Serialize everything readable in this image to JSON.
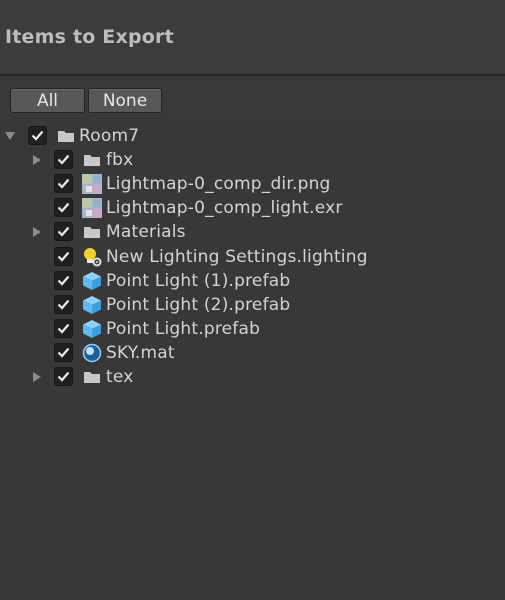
{
  "header": {
    "title": "Items to Export"
  },
  "toolbar": {
    "all_label": "All",
    "none_label": "None"
  },
  "colors": {
    "background": "#383838",
    "header_bg": "#3c3c3c",
    "button_bg": "#585858",
    "checkbox_bg": "#202020",
    "prefab_blue": "#5cb8ef",
    "light_bulb": "#f3d12e",
    "folder": "#c8c8c8"
  },
  "tree": {
    "items": [
      {
        "label": "Room7",
        "icon": "folder-icon",
        "checked": true,
        "expanded": true,
        "has_children": true,
        "depth": 0
      },
      {
        "label": "fbx",
        "icon": "folder-icon",
        "checked": true,
        "expanded": false,
        "has_children": true,
        "depth": 1
      },
      {
        "label": "Lightmap-0_comp_dir.png",
        "icon": "texture-thumbnail-icon",
        "checked": true,
        "has_children": false,
        "depth": 1
      },
      {
        "label": "Lightmap-0_comp_light.exr",
        "icon": "texture-thumbnail-icon",
        "checked": true,
        "has_children": false,
        "depth": 1
      },
      {
        "label": "Materials",
        "icon": "folder-icon",
        "checked": true,
        "expanded": false,
        "has_children": true,
        "depth": 1
      },
      {
        "label": "New Lighting Settings.lighting",
        "icon": "lighting-settings-icon",
        "checked": true,
        "has_children": false,
        "depth": 1
      },
      {
        "label": "Point Light (1).prefab",
        "icon": "prefab-cube-icon",
        "checked": true,
        "has_children": false,
        "depth": 1
      },
      {
        "label": "Point Light (2).prefab",
        "icon": "prefab-cube-icon",
        "checked": true,
        "has_children": false,
        "depth": 1
      },
      {
        "label": "Point Light.prefab",
        "icon": "prefab-cube-icon",
        "checked": true,
        "has_children": false,
        "depth": 1
      },
      {
        "label": "SKY.mat",
        "icon": "material-sphere-icon",
        "checked": true,
        "has_children": false,
        "depth": 1
      },
      {
        "label": "tex",
        "icon": "folder-icon",
        "checked": true,
        "expanded": false,
        "has_children": true,
        "depth": 1
      }
    ]
  }
}
